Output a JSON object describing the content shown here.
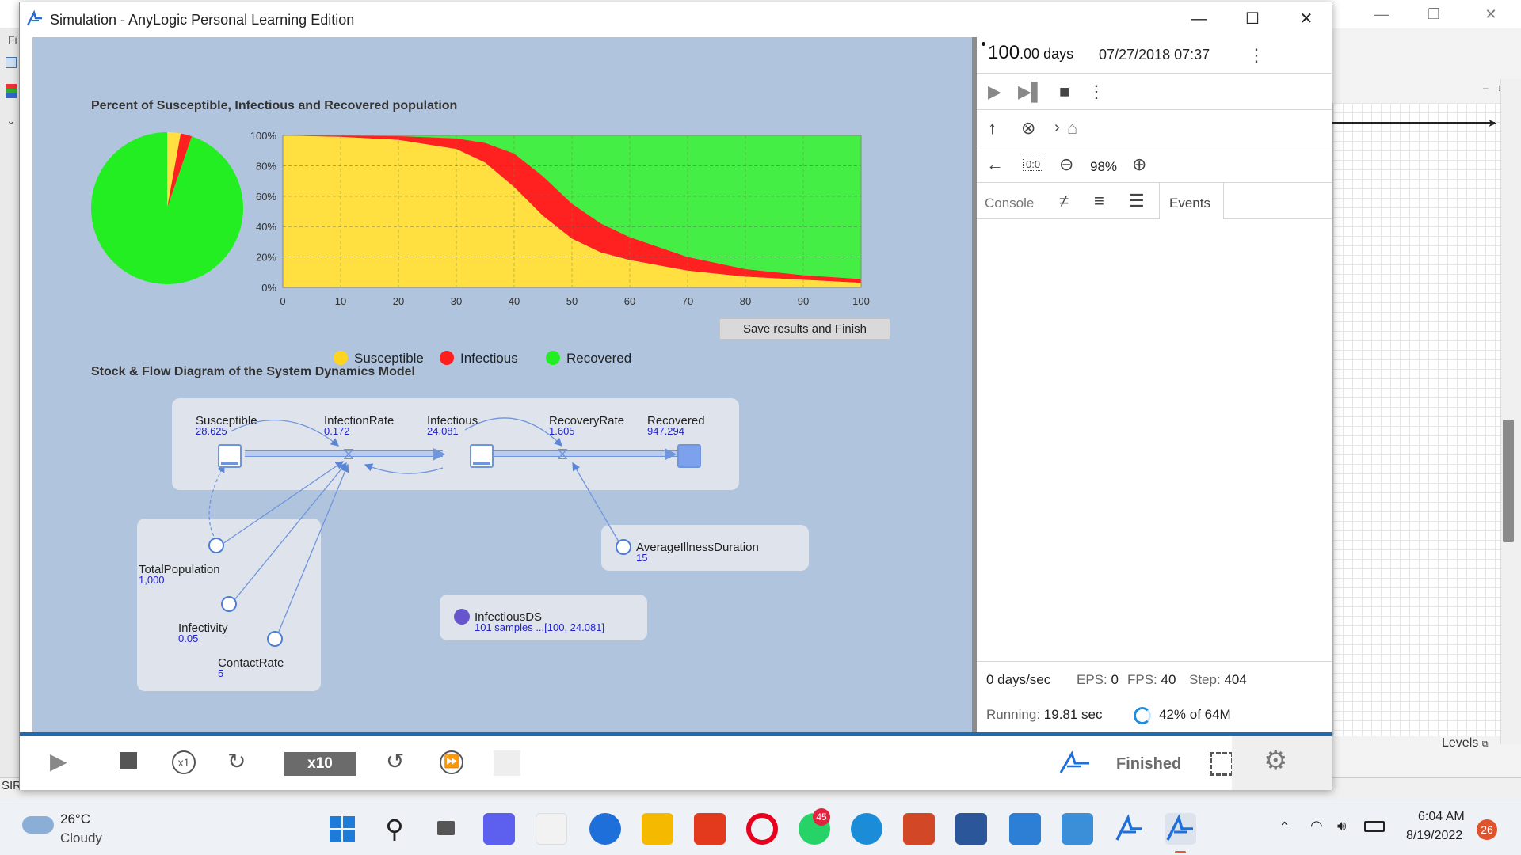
{
  "window": {
    "title": "Simulation - AnyLogic Personal Learning Edition",
    "minimize_icon": "minimize-icon",
    "maximize_icon": "maximize-icon",
    "close_icon": "close-icon"
  },
  "background_app": {
    "menu_letter": "Fi",
    "status_left": "SIR",
    "levels_label": "Levels"
  },
  "chart_section": {
    "title": "Percent of Susceptible, Infectious and Recovered population",
    "save_button": "Save results and Finish"
  },
  "chart_data": [
    {
      "type": "pie",
      "labels": [
        "Susceptible",
        "Infectious",
        "Recovered"
      ],
      "values": [
        2.8625,
        2.4081,
        94.7294
      ],
      "colors": [
        "#ffe040",
        "#ff2020",
        "#22ee22"
      ]
    },
    {
      "type": "area",
      "stacked": true,
      "x": [
        0,
        10,
        20,
        30,
        35,
        40,
        45,
        50,
        55,
        60,
        70,
        80,
        90,
        100
      ],
      "series": [
        {
          "name": "Susceptible",
          "color": "#ffe040",
          "values": [
            99.9,
            99,
            97,
            91,
            82,
            66,
            47,
            32,
            23,
            18,
            11,
            7,
            5,
            3
          ]
        },
        {
          "name": "Infectious",
          "color": "#ff2020",
          "values": [
            0.1,
            0.8,
            2.5,
            7,
            13,
            22,
            26,
            23,
            19,
            15,
            9,
            5,
            3,
            2.5
          ]
        },
        {
          "name": "Recovered",
          "color": "#44ee44",
          "values": [
            0,
            0.2,
            0.5,
            2,
            5,
            12,
            27,
            45,
            58,
            67,
            80,
            88,
            92,
            94.5
          ]
        }
      ],
      "xlim": [
        0,
        100
      ],
      "ylim": [
        0,
        100
      ],
      "x_ticks": [
        "0",
        "10",
        "20",
        "30",
        "40",
        "50",
        "60",
        "70",
        "80",
        "90",
        "100"
      ],
      "y_ticks": [
        "0%",
        "20%",
        "40%",
        "60%",
        "80%",
        "100%"
      ],
      "grid": true,
      "legend": [
        "Susceptible",
        "Infectious",
        "Recovered"
      ],
      "legend_placement": "bottom"
    }
  ],
  "sfd": {
    "title": "Stock & Flow Diagram of the System Dynamics Model",
    "susceptible": {
      "name": "Susceptible",
      "value": "28.625"
    },
    "infection_rate": {
      "name": "InfectionRate",
      "value": "0.172"
    },
    "infectious": {
      "name": "Infectious",
      "value": "24.081"
    },
    "recovery_rate": {
      "name": "RecoveryRate",
      "value": "1.605"
    },
    "recovered": {
      "name": "Recovered",
      "value": "947.294"
    },
    "total_population": {
      "name": "TotalPopulation",
      "value": "1,000"
    },
    "infectivity": {
      "name": "Infectivity",
      "value": "0.05"
    },
    "contact_rate": {
      "name": "ContactRate",
      "value": "5"
    },
    "average_illness_duration": {
      "name": "AverageIllnessDuration",
      "value": "15"
    },
    "infectious_ds": {
      "name": "InfectiousDS",
      "value": "101 samples ...[100, 24.081]"
    }
  },
  "dev_panel": {
    "time_int": "100",
    "time_frac": ".00 days",
    "datetime": "07/27/2018 07:37",
    "zoom": "98%",
    "console_tab": "Console",
    "events_tab": "Events",
    "stats": {
      "speed": "0 days/sec",
      "eps_label": "EPS:",
      "eps": "0",
      "fps_label": "FPS:",
      "fps": "40",
      "step_label": "Step:",
      "step": "404",
      "running_label": "Running:",
      "running": "19.81 sec",
      "memory": "42% of 64M"
    }
  },
  "bottom_bar": {
    "speed": "x10",
    "status": "Finished"
  },
  "taskbar": {
    "temperature": "26°C",
    "weather": "Cloudy",
    "time": "6:04 AM",
    "date": "8/19/2022",
    "notifications": "26",
    "whatsapp_badge": "45"
  }
}
